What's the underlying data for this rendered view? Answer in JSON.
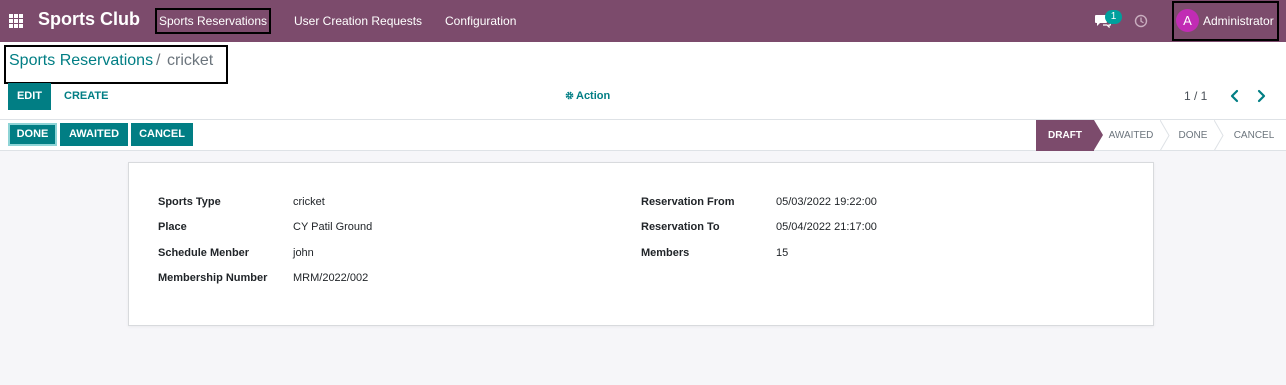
{
  "navbar": {
    "brand": "Sports Club",
    "menu": [
      "Sports Reservations",
      "User Creation Requests",
      "Configuration"
    ],
    "chat_count": "1",
    "user_initial": "A",
    "user_name": "Administrator",
    "icons": [
      "apps-grid-icon",
      "chat-icon",
      "clock-icon"
    ]
  },
  "breadcrumb": {
    "parent": "Sports Reservations",
    "separator": "/",
    "current": "cricket"
  },
  "controls": {
    "edit": "EDIT",
    "create": "CREATE",
    "action": "Action",
    "pager": "1 / 1"
  },
  "status_buttons": [
    "DONE",
    "AWAITED",
    "CANCEL"
  ],
  "stages": [
    "DRAFT",
    "AWAITED",
    "DONE",
    "CANCEL"
  ],
  "form": {
    "left": [
      {
        "label": "Sports Type",
        "value": "cricket"
      },
      {
        "label": "Place",
        "value": "CY Patil Ground"
      },
      {
        "label": "Schedule Menber",
        "value": "john"
      },
      {
        "label": "Membership Number",
        "value": "MRM/2022/002"
      }
    ],
    "right": [
      {
        "label": "Reservation From",
        "value": "05/03/2022 19:22:00"
      },
      {
        "label": "Reservation To",
        "value": "05/04/2022 21:17:00"
      },
      {
        "label": "Members",
        "value": "15"
      }
    ]
  },
  "colors": {
    "navbar": "#7c4b6c",
    "primary": "#017e84",
    "avatar": "#c12cb4",
    "background": "#f6f6f9"
  }
}
